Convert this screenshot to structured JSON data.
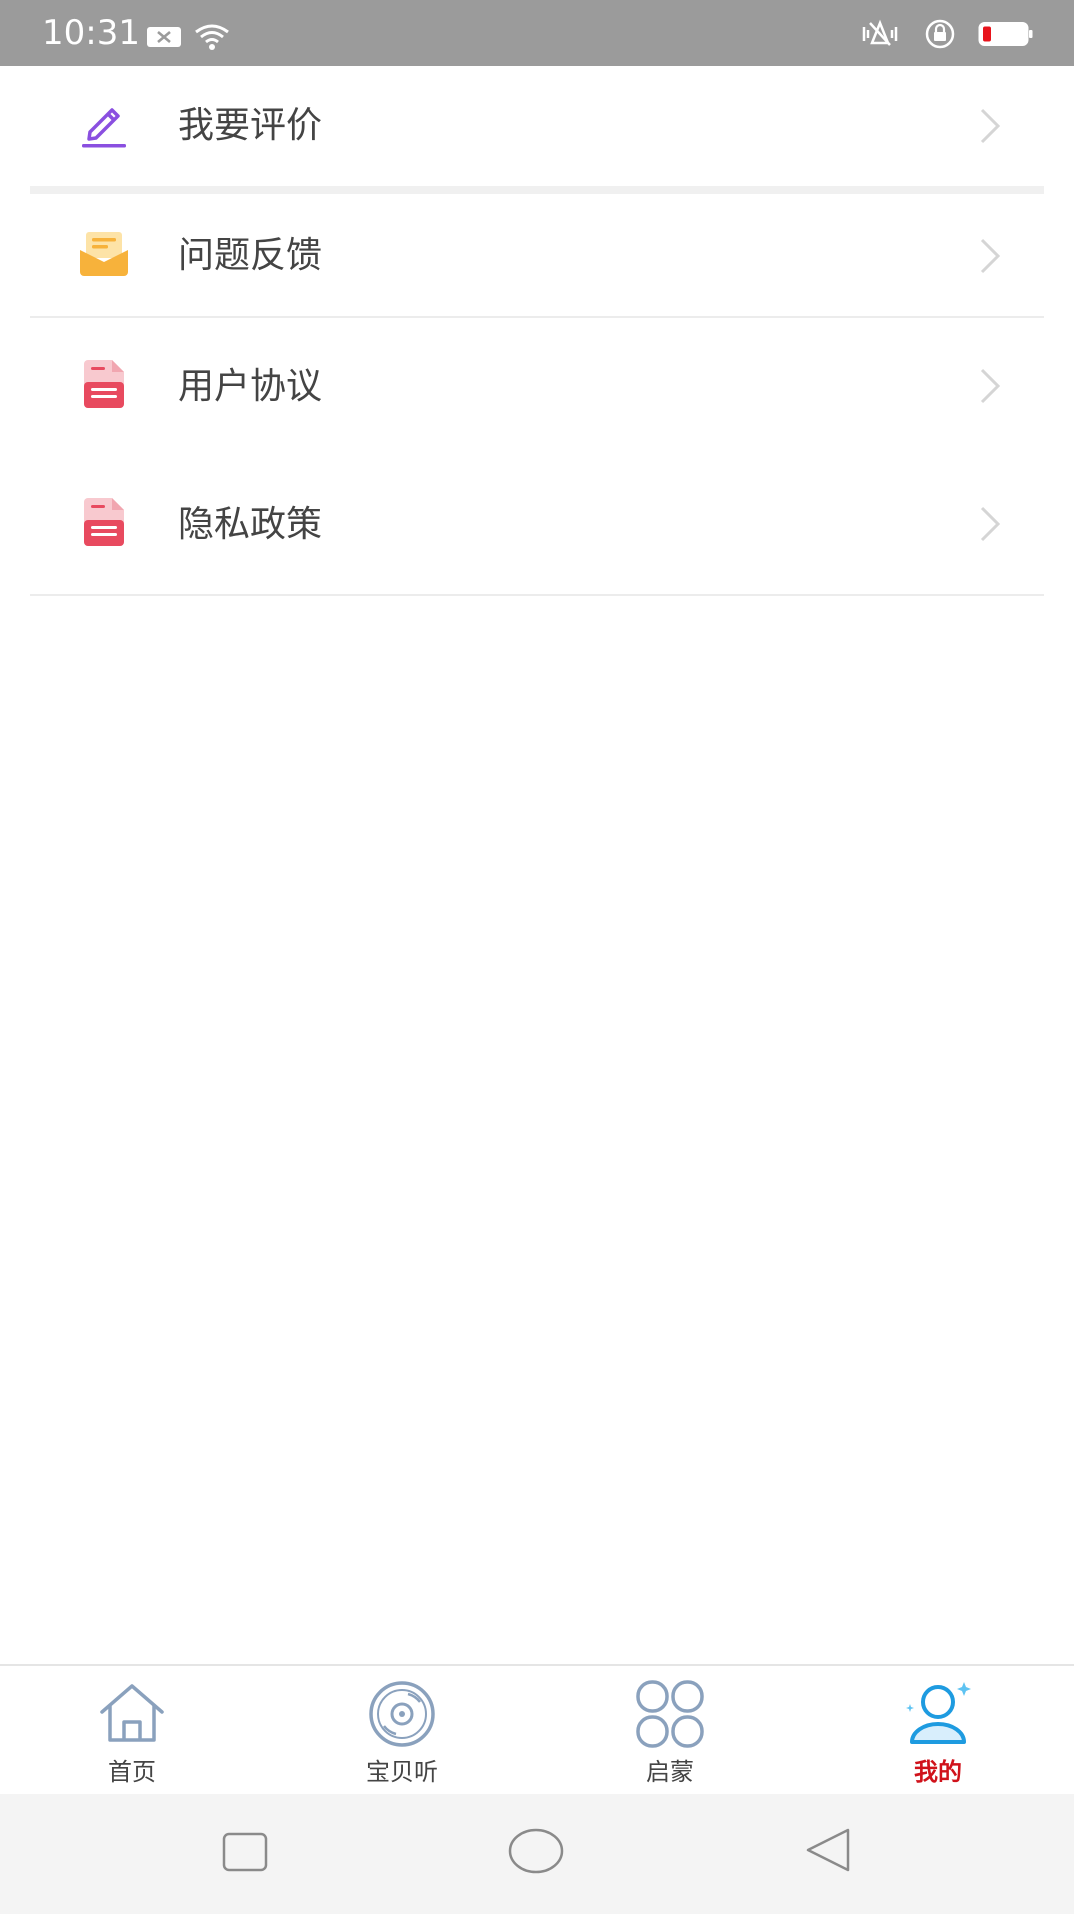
{
  "status_bar": {
    "time": "10:31"
  },
  "menu": {
    "items": [
      {
        "label": "我要评价",
        "icon": "pencil-icon"
      },
      {
        "label": "问题反馈",
        "icon": "mail-icon"
      },
      {
        "label": "用户协议",
        "icon": "document-icon"
      },
      {
        "label": "隐私政策",
        "icon": "document-icon"
      }
    ]
  },
  "tabs": [
    {
      "label": "首页",
      "icon": "home-icon"
    },
    {
      "label": "宝贝听",
      "icon": "disc-icon"
    },
    {
      "label": "启蒙",
      "icon": "grid-icon"
    },
    {
      "label": "我的",
      "icon": "user-icon"
    }
  ],
  "active_tab": "我的",
  "colors": {
    "active": "#d0121b",
    "pencil": "#8a4fe0",
    "mail": "#f7b23b",
    "document": "#e84a5f"
  }
}
